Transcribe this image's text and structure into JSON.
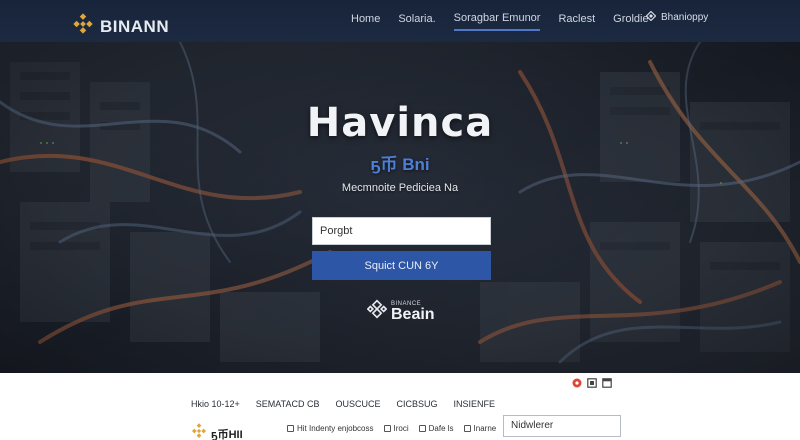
{
  "brand": {
    "name": "BINANN"
  },
  "nav": {
    "items": [
      {
        "label": "Home",
        "active": false
      },
      {
        "label": "Solaria.",
        "active": false
      },
      {
        "label": "Soragbar Emunor",
        "active": true
      },
      {
        "label": "Raclest",
        "active": false
      },
      {
        "label": "Groldie",
        "active": false
      }
    ],
    "user": {
      "label": "Bhanioppy",
      "icon": "diamond-icon"
    }
  },
  "hero": {
    "title": "Havinca",
    "subtitle": "ҕ币 Bni",
    "tagline": "Mecmnoite Pediciea Na",
    "input": {
      "value": "Porgbt",
      "placeholder": ""
    },
    "button_label": "Squict CUN 6Y",
    "logo": {
      "small": "BINANCE",
      "big": "Beain"
    }
  },
  "footer": {
    "icons": [
      "record-icon",
      "square-icon",
      "window-icon"
    ],
    "links": [
      "Hkio 10-12+",
      "SEMATACD CB",
      "OUSCUCE",
      "CICBSUG",
      "INSIENFE"
    ],
    "brand_name": "ҕ币HII",
    "meta": [
      "Hit Indenty enjobcoss",
      "Iroci",
      "Dafe ls",
      "Inarne"
    ],
    "select_value": "Nidwlerer"
  },
  "colors": {
    "nav_bg": "#1b2840",
    "accent": "#2e56a6",
    "subtitle": "#4d7fd6",
    "brand_logo": "#e0a63a"
  }
}
